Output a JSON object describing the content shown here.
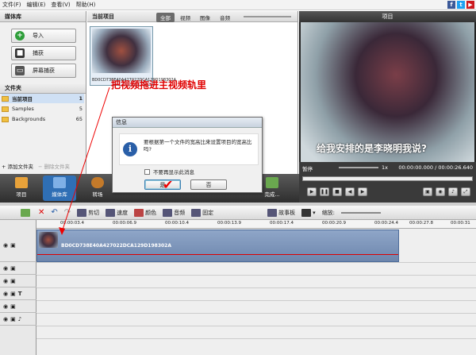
{
  "menu": [
    "文件(F)",
    "编辑(E)",
    "查看(V)",
    "帮助(H)"
  ],
  "social": [
    "f",
    "t",
    "▶"
  ],
  "library": {
    "title": "媒体库",
    "buttons": [
      "导入",
      "捕获",
      "屏幕捕获"
    ],
    "folders_title": "文件夹",
    "folders": [
      {
        "name": "当前项目",
        "count": "1"
      },
      {
        "name": "Samples",
        "count": "5"
      },
      {
        "name": "Backgrounds",
        "count": "65"
      }
    ],
    "add_folder": "添加文件夹",
    "remove_folder": "删除文件夹"
  },
  "project": {
    "title": "当前项目",
    "tabs": [
      "全部",
      "视频",
      "图像",
      "音频"
    ],
    "clip_name": "BD0CD738E40A427022DCA129D198302A"
  },
  "preview": {
    "title": "项目",
    "subtitle": "给我安排的是李晓明我说?",
    "state": "暂停",
    "speed": "1x",
    "time": "00:00:00.000 / 00:00:26.640"
  },
  "modes": [
    "项目",
    "媒体库",
    "转场",
    "",
    "",
    "",
    "完成..."
  ],
  "annotation": "把视频拖进主视频轨里",
  "dialog": {
    "title": "信息",
    "message": "要根据第一个文件的宽高比来设置项目的宽高比吗?",
    "checkbox": "不要再显示此消息",
    "yes": "是",
    "no": "否"
  },
  "timeline_tools": [
    "剪切",
    "速度",
    "颜色",
    "音频",
    "固定",
    "故事板",
    "缩放:"
  ],
  "ruler": [
    "00:00:03.4",
    "00:00:06.9",
    "00:00:10.4",
    "00:00:13.9",
    "00:00:17.4",
    "00:00:20.9",
    "00:00:24.4",
    "00:00:27.8",
    "00:00:31"
  ],
  "clip": {
    "title": "BD0CD738E40A427022DCA129D198302A"
  }
}
